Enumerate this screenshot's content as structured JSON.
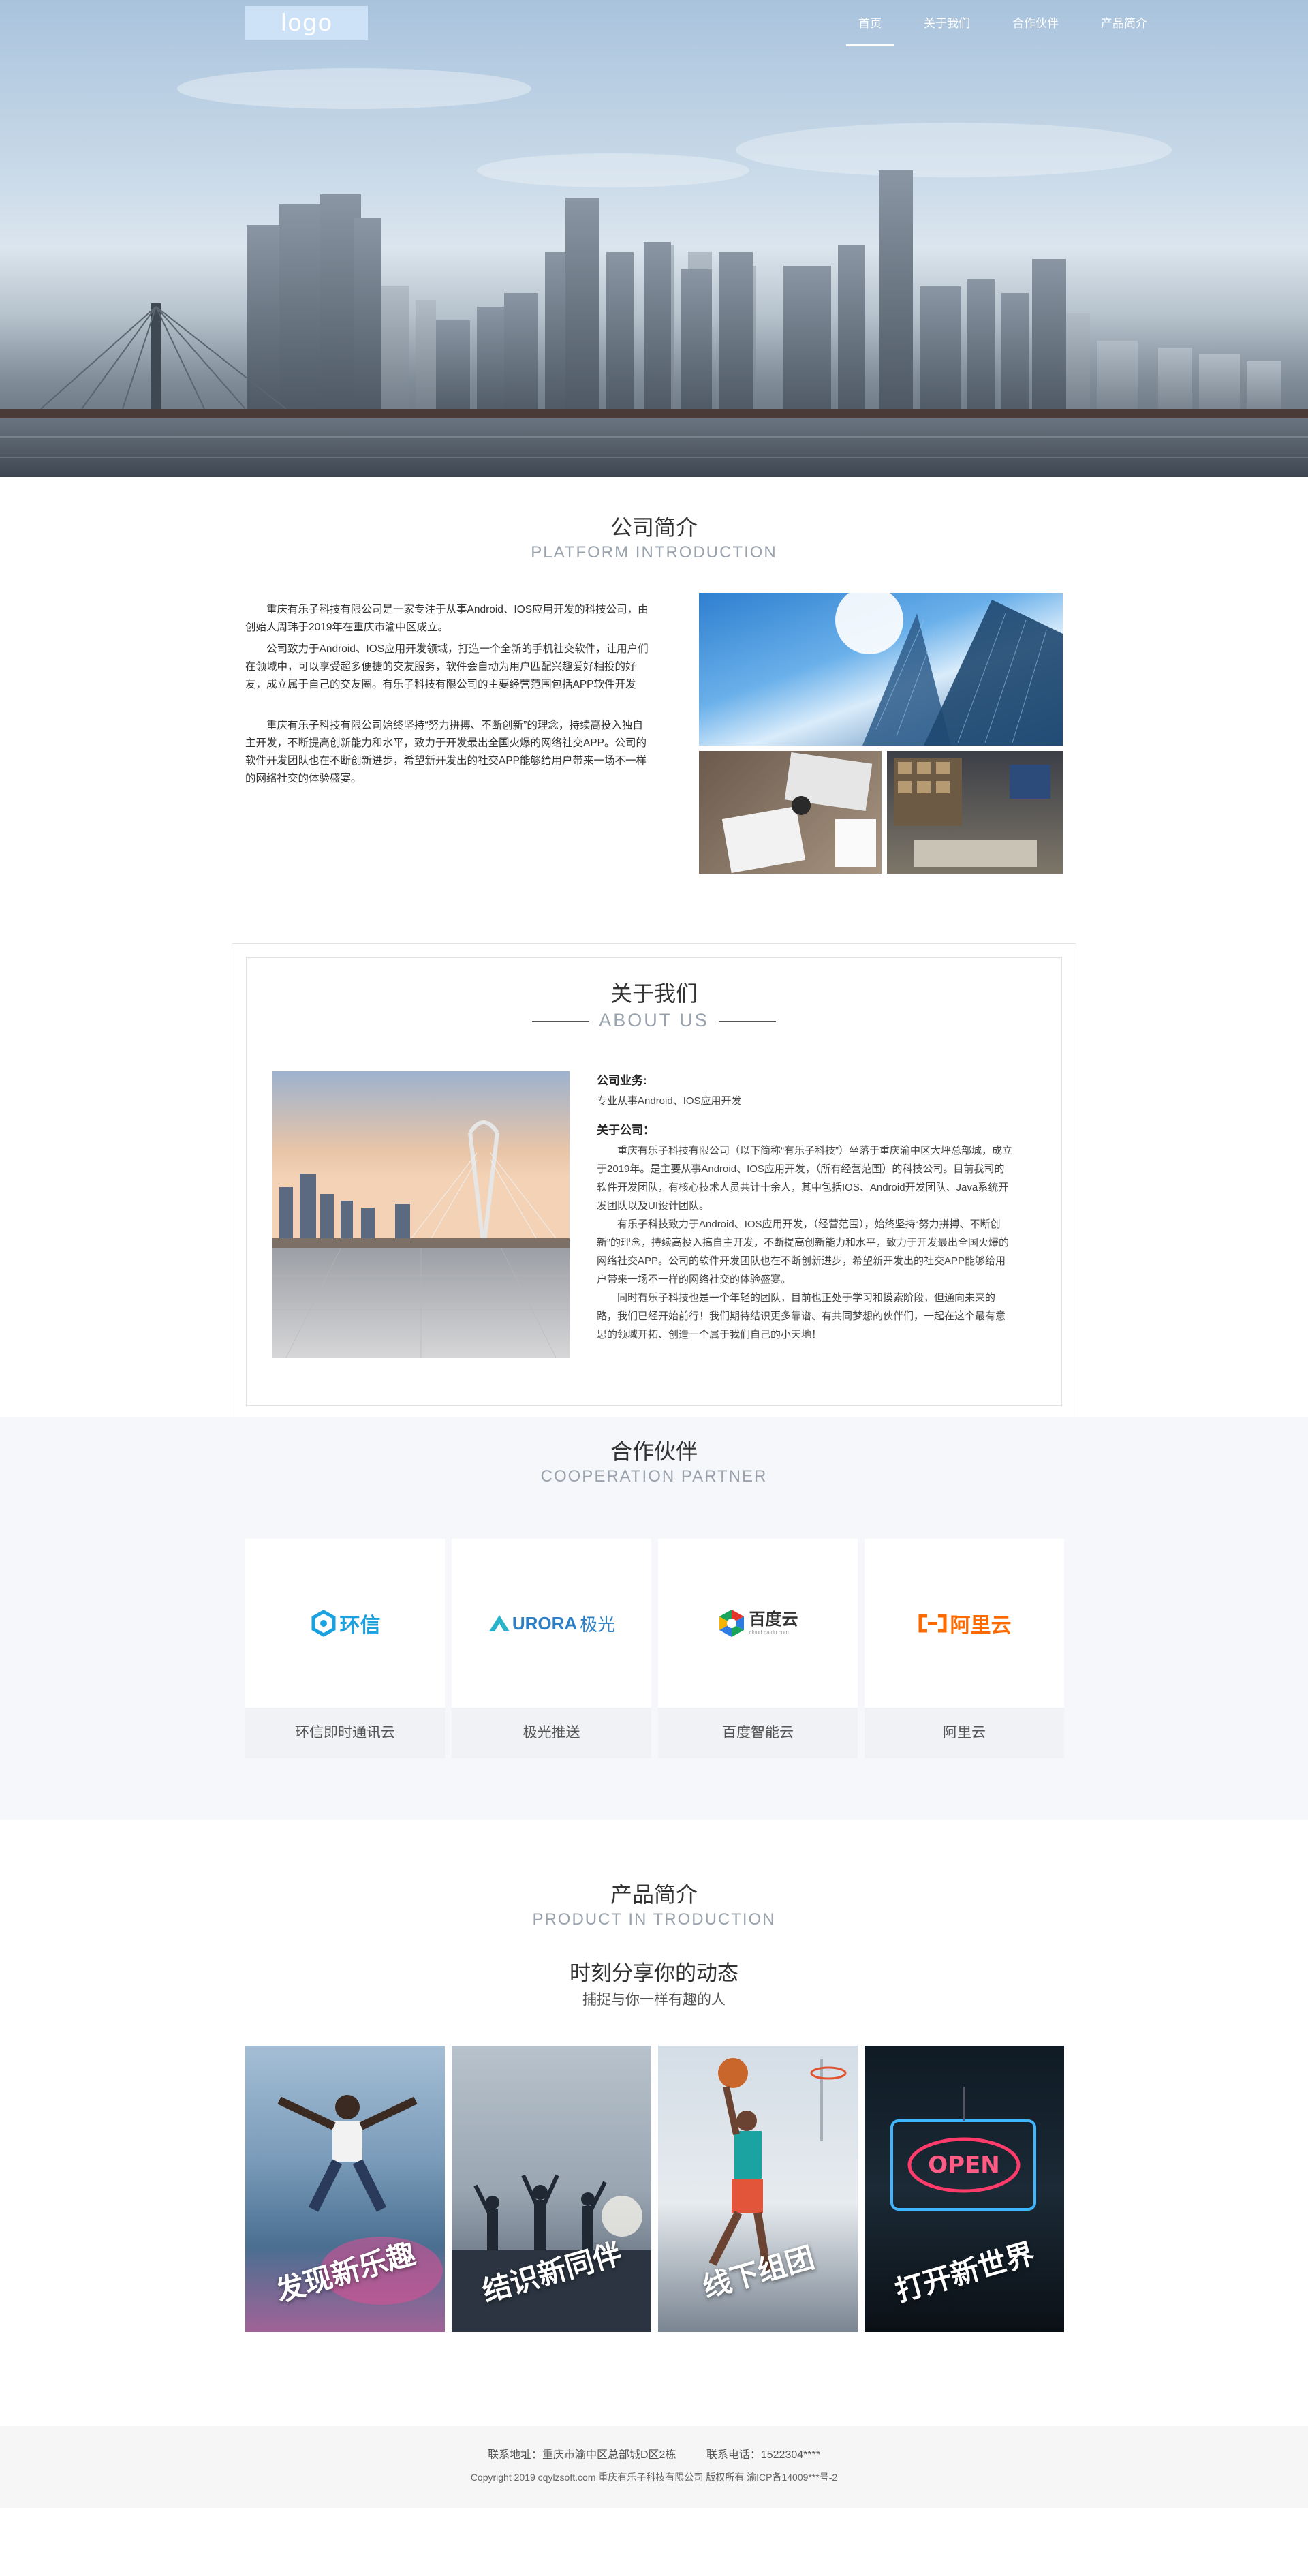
{
  "nav": {
    "logo": "logo",
    "items": [
      "首页",
      "关于我们",
      "合作伙伴",
      "产品简介"
    ]
  },
  "intro": {
    "title_cn": "公司简介",
    "title_en": "PLATFORM INTRODUCTION",
    "paragraphs": [
      "重庆有乐子科技有限公司是一家专注于从事Android、IOS应用开发的科技公司，由创始人周玮于2019年在重庆市渝中区成立。",
      "公司致力于Android、IOS应用开发领域，打造一个全新的手机社交软件，让用户们在领域中，可以享受超多便捷的交友服务，软件会自动为用户匹配兴趣爱好相投的好友，成立属于自己的交友圈。有乐子科技有限公司的主要经营范围包括APP软件开发",
      "重庆有乐子科技有限公司始终坚持“努力拼搏、不断创新”的理念，持续高投入独自主开发，不断提高创新能力和水平，致力于开发最出全国火爆的网络社交APP。公司的软件开发团队也在不断创新进步，希望新开发出的社交APP能够给用户带来一场不一样的网络社交的体验盛宴。"
    ]
  },
  "about": {
    "title_cn": "关于我们",
    "title_en": "ABOUT US",
    "business_label": "公司业务:",
    "business_text": "专业从事Android、IOS应用开发",
    "company_label": "关于公司：",
    "paragraphs": [
      "重庆有乐子科技有限公司（以下简称“有乐子科技”）坐落于重庆渝中区大坪总部城，成立于2019年。是主要从事Android、IOS应用开发，（所有经营范围）的科技公司。目前我司的软件开发团队，有核心技术人员共计十余人，其中包括IOS、Android开发团队、Java系统开发团队以及UI设计团队。",
      "有乐子科技致力于Android、IOS应用开发，（经营范围），始终坚持“努力拼搏、不断创新”的理念，持续高投入搞自主开发，不断提高创新能力和水平，致力于开发最出全国火爆的网络社交APP。公司的软件开发团队也在不断创新进步，希望新开发出的社交APP能够给用户带来一场不一样的网络社交的体验盛宴。",
      "同时有乐子科技也是一个年轻的团队，目前也正处于学习和摸索阶段，但通向未来的路，我们已经开始前行！我们期待结识更多靠谱、有共同梦想的伙伴们，一起在这个最有意思的领域开拓、创造一个属于我们自己的小天地！"
    ]
  },
  "partners": {
    "title_cn": "合作伙伴",
    "title_en": "COOPERATION PARTNER",
    "items": [
      {
        "logo_text": "环信",
        "name": "环信即时通讯云",
        "color": "#1aa1e0"
      },
      {
        "logo_text": "URORA",
        "logo_text2": "极光",
        "name": "极光推送",
        "color": "#2c7fc4"
      },
      {
        "logo_text": "百度云",
        "logo_sub": "cloud.baidu.com",
        "name": "百度智能云",
        "color": "#333333"
      },
      {
        "logo_text": "阿里云",
        "name": "阿里云",
        "color": "#ff6a00"
      }
    ]
  },
  "products": {
    "title_cn": "产品简介",
    "title_en": "PRODUCT IN TRODUCTION",
    "headline": "时刻分享你的动态",
    "subline": "捕捉与你一样有趣的人",
    "items": [
      {
        "caption": "发现新乐趣"
      },
      {
        "caption": "结识新同伴"
      },
      {
        "caption": "线下组团"
      },
      {
        "caption": "打开新世界"
      }
    ],
    "neon_text": "OPEN"
  },
  "footer": {
    "address": "联系地址：重庆市渝中区总部城D区2栋",
    "phone": "联系电话：1522304****",
    "copyright": "Copyright  2019  cqylzsoft.com  重庆有乐子科技有限公司 版权所有  渝ICP备14009***号-2"
  }
}
